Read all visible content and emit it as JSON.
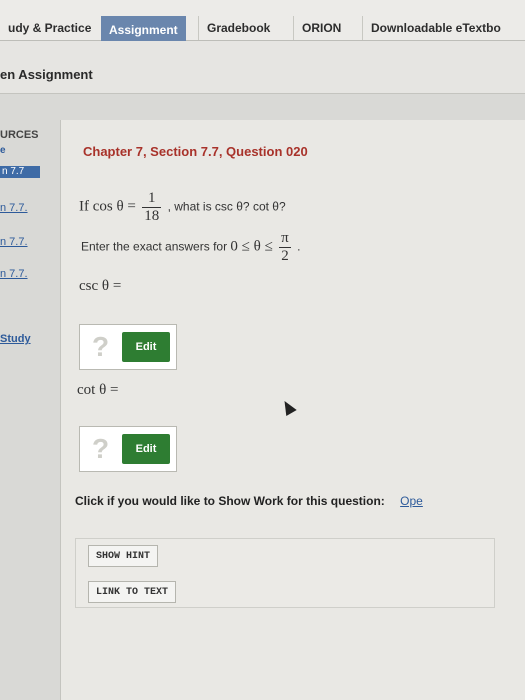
{
  "nav": {
    "tabs": [
      "udy & Practice",
      "Assignment",
      "Gradebook",
      "ORION",
      "Downloadable eTextbo"
    ]
  },
  "subheader": {
    "title": "en Assignment"
  },
  "sidebar": {
    "heading": "URCES",
    "mark": "e",
    "active_link": "n 7.7",
    "links": [
      "n 7.7.",
      "n 7.7.",
      "n 7.7."
    ],
    "study": "Study"
  },
  "question": {
    "chapter": "Chapter 7, Section 7.7, Question 020",
    "if_cos": "If cos θ =",
    "frac_num": "1",
    "frac_den": "18",
    "what_is": ", what is csc θ? cot θ?",
    "enter": "Enter the exact answers for",
    "range": "0 ≤ θ ≤",
    "range_num": "π",
    "range_den": "2",
    "range_end": ".",
    "csc_label": "csc θ =",
    "cot_label": "cot θ =",
    "q_mark": "?",
    "edit_label": "Edit"
  },
  "showwork": {
    "text": "Click if you would like to Show Work for this question:",
    "open": "Ope"
  },
  "buttons": {
    "hint": "SHOW HINT",
    "link": "LINK TO TEXT"
  }
}
